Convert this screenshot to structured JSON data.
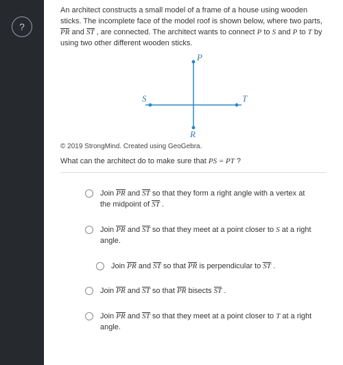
{
  "rail": {
    "help_label": "?"
  },
  "question": {
    "p1a": "An architect constructs a small model of a frame of a house using wooden sticks. The incomplete face of the model roof is shown below, where two parts, ",
    "seg1": "PR",
    "p1b": " and ",
    "seg2": "ST",
    "p1c": " , are connected. The architect wants to connect ",
    "v1": "P",
    "p1d": " to ",
    "v2": "S",
    "p1e": " and ",
    "v3": "P",
    "p1f": " to ",
    "v4": "T",
    "p1g": " by using two other different wooden sticks."
  },
  "diagram": {
    "P": "P",
    "S": "S",
    "T": "T",
    "R": "R"
  },
  "copyright": "© 2019 StrongMind. Created using GeoGebra.",
  "prompt": {
    "a": "What can the architect do to make sure that ",
    "eq": "PS = PT",
    "b": "?"
  },
  "choices": [
    {
      "a": "Join ",
      "s1": "PR",
      "b": " and ",
      "s2": "ST",
      "c": " so that they form a right angle with a vertex at the midpoint of ",
      "s3": "ST",
      "d": " ."
    },
    {
      "a": "Join ",
      "s1": "PR",
      "b": " and ",
      "s2": "ST",
      "c": " so that they meet at a point closer to ",
      "v": "S",
      "d": " at a right angle."
    },
    {
      "a": "Join ",
      "s1": "PR",
      "b": " and ",
      "s2": "ST",
      "c": " so that ",
      "s3": "PR",
      "d": " is perpendicular to ",
      "s4": "ST",
      "e": " ."
    },
    {
      "a": "Join ",
      "s1": "PR",
      "b": " and ",
      "s2": "ST",
      "c": " so that ",
      "s3": "PR",
      "d": " bisects ",
      "s4": "ST",
      "e": " ."
    },
    {
      "a": "Join ",
      "s1": "PR",
      "b": " and ",
      "s2": "ST",
      "c": " so that they meet at a point closer to ",
      "v": "T",
      "d": " at a right angle."
    }
  ]
}
